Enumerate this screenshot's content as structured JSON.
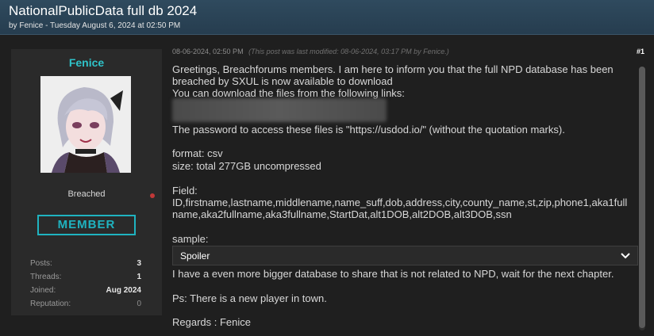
{
  "thread": {
    "title": "NationalPublicData full db 2024",
    "meta": "by Fenice - Tuesday August 6, 2024 at 02:50 PM"
  },
  "user": {
    "name": "Fenice",
    "status": "Breached",
    "rank": "MEMBER",
    "stats": [
      {
        "label": "Posts:",
        "value": "3"
      },
      {
        "label": "Threads:",
        "value": "1"
      },
      {
        "label": "Joined:",
        "value": "Aug 2024"
      },
      {
        "label": "Reputation:",
        "value": "0"
      }
    ]
  },
  "post": {
    "date": "08-06-2024, 02:50 PM",
    "edit_note": "(This post was last modified: 08-06-2024, 03:17 PM by Fenice.)",
    "number": "#1",
    "lines": [
      "Greetings, Breachforums members. I am here to inform you that the full NPD database has been",
      "breached by SXUL is now available to download",
      "You can download the files from the following links:",
      "The password to access these files is \"https://usdod.io/\" (without the quotation marks).",
      "format: csv",
      "size: total 277GB uncompressed",
      "Field:",
      "ID,firstname,lastname,middlename,name_suff,dob,address,city,county_name,st,zip,phone1,aka1full",
      "name,aka2fullname,aka3fullname,StartDat,alt1DOB,alt2DOB,alt3DOB,ssn",
      "sample:",
      "I have a even more bigger database to share that is not related to NPD, wait for the next chapter.",
      "Ps: There is a new player in town.",
      "Regards : Fenice"
    ],
    "spoiler_label": "Spoiler"
  },
  "colors": {
    "header_bg": "#2b4457",
    "username": "#2fc3c9",
    "rank_badge": "#1fb3c0",
    "status_dot": "#c13838"
  }
}
